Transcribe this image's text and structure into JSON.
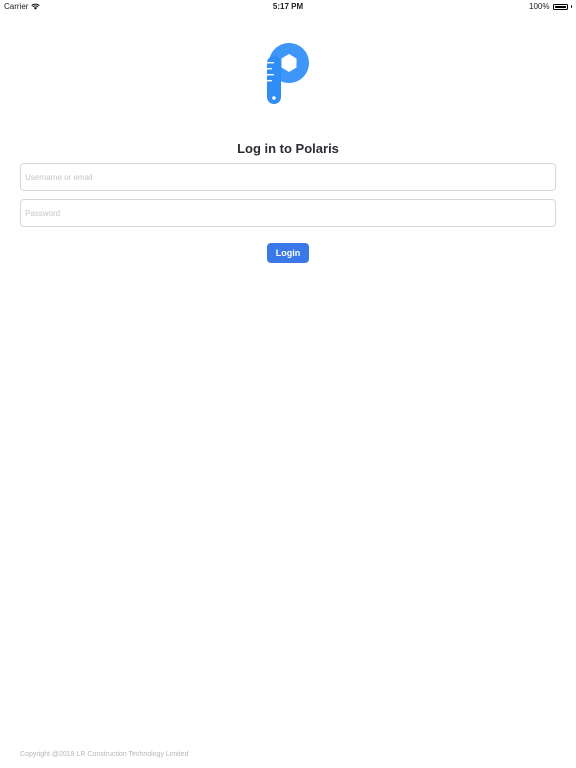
{
  "status_bar": {
    "carrier": "Carrier",
    "wifi_icon": "wifi-icon",
    "time": "5:17 PM",
    "battery_percent": "100%",
    "battery_level": 1.0,
    "battery_icon": "battery-icon"
  },
  "logo": {
    "icon": "polaris-logo-icon",
    "colors": {
      "primary": "#2f8df5",
      "light": "#5aa8ff",
      "white": "#ffffff"
    }
  },
  "login": {
    "title": "Log in to Polaris",
    "username_placeholder": "Username or email",
    "username_value": "",
    "password_placeholder": "Password",
    "password_value": "",
    "button_label": "Login",
    "button_color": "#3b78e7"
  },
  "footer": {
    "copyright": "Copyright @2018 LR Construction Technology Limited"
  }
}
